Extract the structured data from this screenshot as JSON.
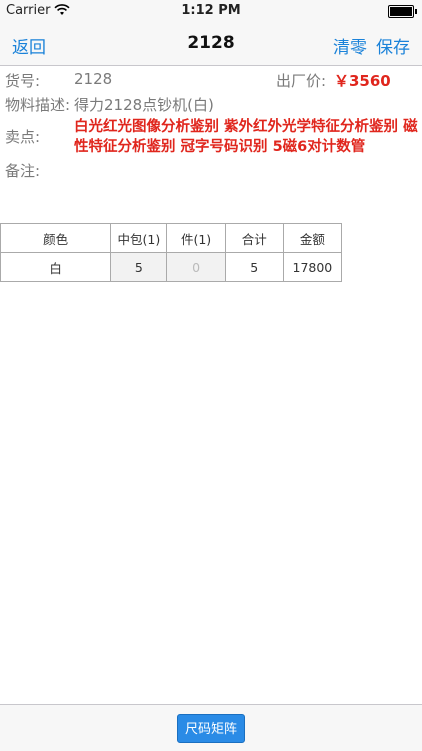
{
  "status_bar": {
    "carrier": "Carrier",
    "time": "1:12 PM"
  },
  "nav": {
    "back_label": "返回",
    "title": "2128",
    "clear_label": "清零",
    "save_label": "保存"
  },
  "info": {
    "item_no_label": "货号:",
    "item_no_value": "2128",
    "factory_price_label": "出厂价:",
    "factory_price_value": "￥3560",
    "description_label": "物料描述:",
    "description_value": "得力2128点钞机(白)",
    "selling_points_label": "卖点:",
    "selling_points_value": "白光红光图像分析鉴别 紫外红外光学特征分析鉴别 磁性特征分析鉴别 冠字号码识别 5磁6对计数管",
    "remarks_label": "备注:"
  },
  "table": {
    "headers": [
      "颜色",
      "中包(1)",
      "件(1)",
      "合计",
      "金额"
    ],
    "rows": [
      [
        "白",
        "5",
        "0",
        "5",
        "17800"
      ]
    ]
  },
  "toolbar": {
    "size_matrix_label": "尺码矩阵"
  },
  "colors": {
    "accent": "#1a82d9",
    "price_red": "#e0261d",
    "button_blue": "#2a8be6"
  }
}
